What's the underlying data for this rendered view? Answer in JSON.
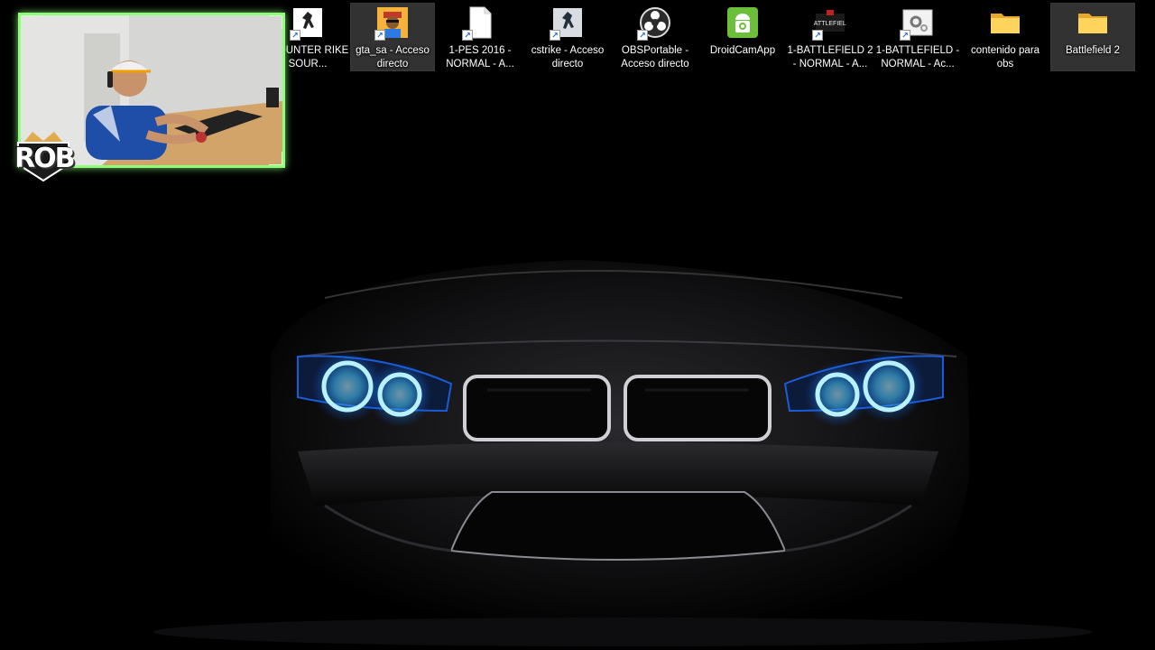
{
  "desktop": {
    "icons": [
      {
        "label": "-COUNTER RIKE SOUR...",
        "icon": "counter-strike-source-icon",
        "shortcut": true
      },
      {
        "label": "gta_sa - Acceso directo",
        "icon": "gta-sa-icon",
        "shortcut": true,
        "selected": true
      },
      {
        "label": "1-PES 2016 - NORMAL - A...",
        "icon": "file-icon",
        "shortcut": true
      },
      {
        "label": "cstrike - Acceso directo",
        "icon": "counter-strike-icon",
        "shortcut": true
      },
      {
        "label": "OBSPortable - Acceso directo",
        "icon": "obs-icon",
        "shortcut": true
      },
      {
        "label": "DroidCamApp",
        "icon": "droidcam-icon",
        "shortcut": false
      },
      {
        "label": "1-BATTLEFIELD 2 - NORMAL - A...",
        "icon": "battlefield-2-icon",
        "shortcut": true
      },
      {
        "label": "1-BATTLEFIELD - NORMAL - Ac...",
        "icon": "settings-file-icon",
        "shortcut": true
      },
      {
        "label": "contenido para obs",
        "icon": "folder-icon",
        "shortcut": false
      },
      {
        "label": "Battlefield 2",
        "icon": "folder-icon",
        "shortcut": false,
        "selected": true
      }
    ]
  },
  "webcam": {
    "badge_text": "ROB",
    "accent_color": "#8fff7a"
  },
  "wallpaper": {
    "subject": "car-front",
    "headlight_color": "#2f9bff"
  }
}
